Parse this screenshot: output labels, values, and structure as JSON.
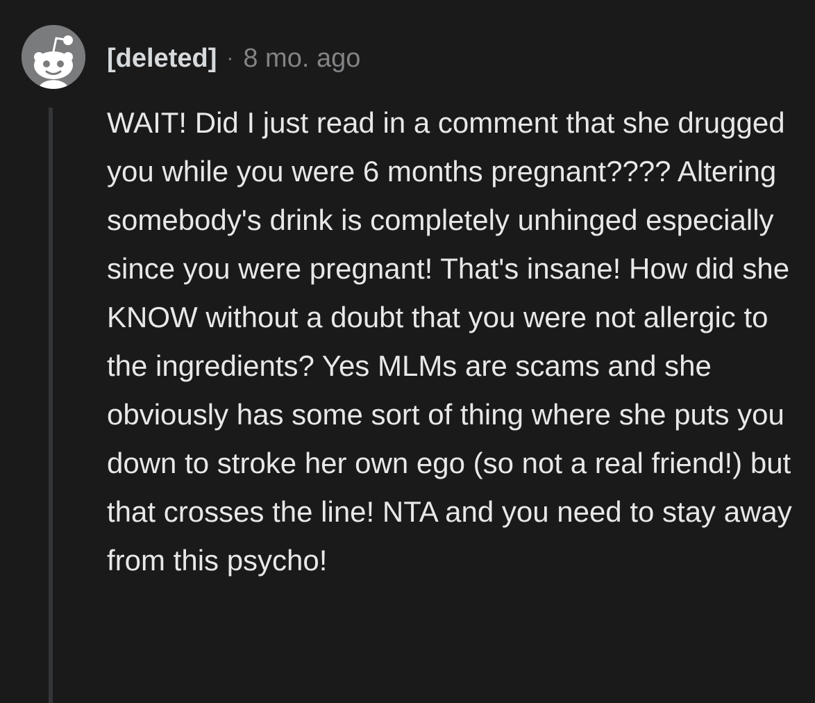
{
  "comment": {
    "author": "[deleted]",
    "separator": "·",
    "timestamp": "8 mo. ago",
    "avatar_icon": "snoo-avatar-icon",
    "body": "WAIT! Did I just read in a comment that she drugged you while you were 6 months pregnant???? Altering somebody's drink is completely unhinged especially since you were pregnant! That's insane! How did she KNOW without a doubt that you were not allergic to the ingredients? Yes MLMs are scams and she obviously has some sort of thing where she puts you down to stroke her own ego (so not a real friend!) but that crosses the line! NTA and you need to stay away from this psycho!"
  },
  "colors": {
    "background": "#1a1a1b",
    "avatar_bg": "#7a7b7d",
    "text": "#e8e8e8",
    "meta": "#818384",
    "thread_line": "#343536"
  }
}
